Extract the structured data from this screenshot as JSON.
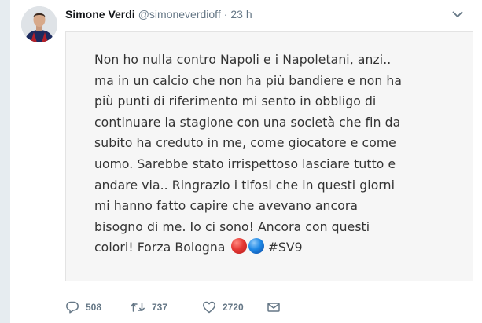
{
  "tweet": {
    "author_name": "Simone Verdi",
    "author_handle": "@simoneverdioff",
    "separator": "·",
    "timestamp": "23 h",
    "statement_lines": [
      "Non ho nulla contro Napoli e i Napoletani, anzi..",
      "ma in un calcio che non ha più bandiere e non ha",
      "più punti di riferimento mi sento in obbligo di",
      "continuare la stagione con una società che fin da",
      "subito ha creduto in me, come giocatore e come",
      "uomo. Sarebbe stato irrispettoso lasciare tutto e",
      "andare via.. Ringrazio i tifosi che in questi giorni",
      "mi hanno fatto capire che avevano ancora",
      "bisogno di me. Io ci sono! Ancora con questi"
    ],
    "statement_last_line": "colori! Forza Bologna",
    "hashtag": "#SV9",
    "emoji": [
      {
        "name": "red-circle",
        "color": "#e53935"
      },
      {
        "name": "blue-circle",
        "color": "#1e88e5"
      }
    ]
  },
  "actions": {
    "reply": {
      "icon": "reply-icon",
      "count": "508"
    },
    "retweet": {
      "icon": "retweet-icon",
      "count": "737"
    },
    "like": {
      "icon": "heart-icon",
      "count": "2720"
    },
    "message": {
      "icon": "envelope-icon"
    }
  },
  "colors": {
    "text_primary": "#14171a",
    "text_secondary": "#657786",
    "card_background": "#f6f6f6"
  }
}
